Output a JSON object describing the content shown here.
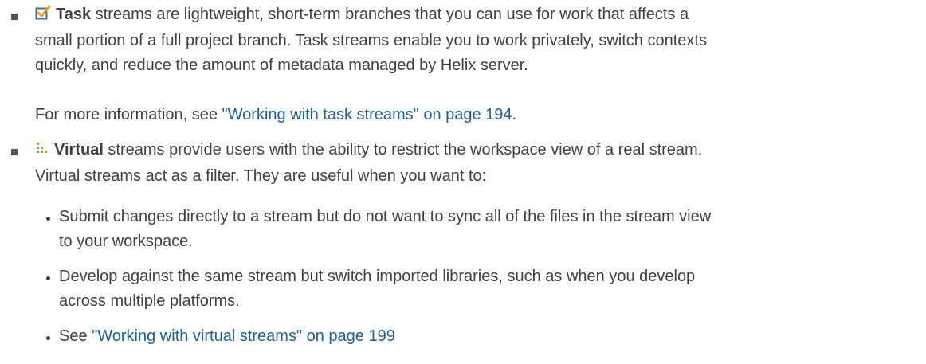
{
  "task_item": {
    "icon": "task-stream-checkbox-icon",
    "term": "Task",
    "text_1": " streams are lightweight, short-term branches that you can use for work that affects a",
    "text_2": "small portion of a full project branch. Task streams enable you to work privately, switch contexts",
    "text_3": "quickly, and reduce the amount of metadata managed by Helix server.",
    "more_prefix": "For more information, see ",
    "more_link": "\"Working with task streams\" on page 194",
    "more_suffix": "."
  },
  "virtual_item": {
    "icon": "virtual-stream-dots-icon",
    "term": "Virtual",
    "text_1": " streams provide users with the ability to restrict the workspace view of a real stream.",
    "text_2": "Virtual streams act as a filter. They are useful when you want to:",
    "bullets": [
      {
        "line_1": "Submit changes directly to a stream but do not want to sync all of the files in the stream view",
        "line_2": "to your workspace."
      },
      {
        "line_1": "Develop against the same stream but switch imported libraries, such as when you develop",
        "line_2": "across multiple platforms."
      }
    ],
    "see_prefix": "See ",
    "see_link": "\"Working with virtual streams\" on page 199"
  },
  "colors": {
    "text": "#404040",
    "link": "#1f5f96",
    "task_icon_check": "#e8a317",
    "task_icon_box": "#4a6fa5",
    "virtual_icon_green": "#6aa84f",
    "virtual_icon_orange": "#e69138"
  }
}
